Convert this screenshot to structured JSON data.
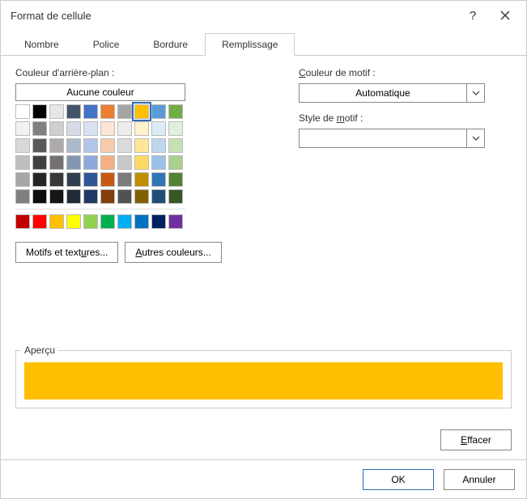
{
  "window": {
    "title": "Format de cellule"
  },
  "tabs": {
    "t0": "Nombre",
    "t1": "Police",
    "t2": "Bordure",
    "t3": "Remplissage"
  },
  "labels": {
    "bgColor": "Couleur d'arrière-plan :",
    "noColor": "Aucune couleur",
    "patternColor": "Couleur de motif :",
    "patternStyle": "Style de motif :",
    "preview": "Aperçu",
    "fillEffects": "Motifs et textures...",
    "moreColors": "Autres couleurs...",
    "clear": "Effacer",
    "ok": "OK",
    "cancel": "Annuler"
  },
  "combo": {
    "patternColor": "Automatique",
    "patternStyle": ""
  },
  "palette": {
    "theme": [
      "#ffffff",
      "#000000",
      "#e7e6e6",
      "#44546a",
      "#4472c4",
      "#ed7d31",
      "#a5a5a5",
      "#ffc000",
      "#5b9bd5",
      "#70ad47",
      "#f2f2f2",
      "#808080",
      "#d0cece",
      "#d6dce5",
      "#d9e1f2",
      "#fce4d6",
      "#ededed",
      "#fff2cc",
      "#ddebf7",
      "#e2efda",
      "#d9d9d9",
      "#595959",
      "#aeaaaa",
      "#acb9ca",
      "#b4c6e7",
      "#f8cbad",
      "#dbdbdb",
      "#ffe699",
      "#bdd7ee",
      "#c6e0b4",
      "#bfbfbf",
      "#404040",
      "#757171",
      "#8497b0",
      "#8ea9db",
      "#f4b084",
      "#c9c9c9",
      "#ffd966",
      "#9bc2e6",
      "#a9d08e",
      "#a6a6a6",
      "#262626",
      "#3a3838",
      "#333f4f",
      "#305496",
      "#c65911",
      "#7b7b7b",
      "#bf8f00",
      "#2f75b5",
      "#548235",
      "#808080",
      "#0d0d0d",
      "#161616",
      "#222b35",
      "#203764",
      "#833c0c",
      "#525252",
      "#806000",
      "#1f4e78",
      "#375623"
    ],
    "standard": [
      "#c00000",
      "#ff0000",
      "#ffc000",
      "#ffff00",
      "#92d050",
      "#00b050",
      "#00b0f0",
      "#0070c0",
      "#002060",
      "#7030a0"
    ],
    "selectedIndex": 7
  },
  "preview": {
    "color": "#ffbe00"
  }
}
